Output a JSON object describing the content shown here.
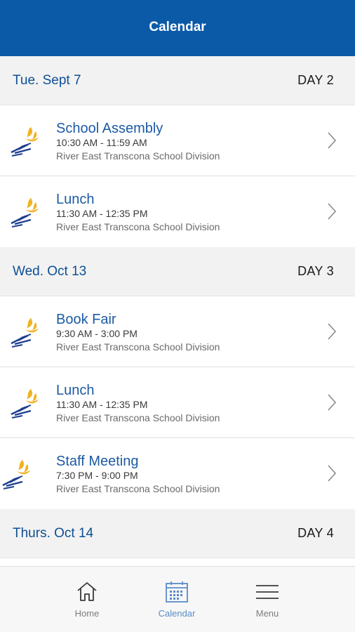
{
  "header": {
    "title": "Calendar"
  },
  "days": [
    {
      "date": "Tue. Sept 7",
      "day_label": "DAY 2",
      "events": [
        {
          "title": "School Assembly",
          "time": "10:30 AM - 11:59 AM",
          "org": "River East Transcona School Division"
        },
        {
          "title": "Lunch",
          "time": "11:30 AM - 12:35 PM",
          "org": "River East Transcona School Division"
        }
      ]
    },
    {
      "date": "Wed. Oct 13",
      "day_label": "DAY 3",
      "events": [
        {
          "title": "Book Fair",
          "time": "9:30 AM - 3:00 PM",
          "org": "River East Transcona School Division"
        },
        {
          "title": "Lunch",
          "time": "11:30 AM - 12:35 PM",
          "org": "River East Transcona School Division"
        },
        {
          "title": "Staff Meeting",
          "time": "7:30 PM - 9:00 PM",
          "org": "River East Transcona School Division"
        }
      ]
    },
    {
      "date": "Thurs. Oct 14",
      "day_label": "DAY 4",
      "events": []
    }
  ],
  "tabbar": {
    "items": [
      {
        "label": "Home",
        "icon": "home-icon",
        "active": false
      },
      {
        "label": "Calendar",
        "icon": "calendar-icon",
        "active": true
      },
      {
        "label": "Menu",
        "icon": "menu-icon",
        "active": false
      }
    ]
  },
  "colors": {
    "header_bg": "#0a5aa8",
    "accent": "#1d5aa3",
    "logo_flame": "#f0b323",
    "logo_stairs": "#1e3f8f"
  }
}
